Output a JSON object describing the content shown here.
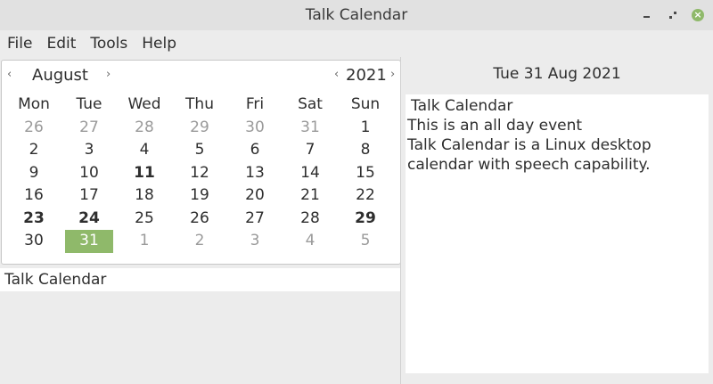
{
  "window": {
    "title": "Talk Calendar"
  },
  "menu": [
    "File",
    "Edit",
    "Tools",
    "Help"
  ],
  "calendar": {
    "month": "August",
    "year": "2021",
    "month_prev": "‹",
    "month_next": "›",
    "year_prev": "‹",
    "year_next": "›",
    "weekdays": [
      "Mon",
      "Tue",
      "Wed",
      "Thu",
      "Fri",
      "Sat",
      "Sun"
    ],
    "weeks": [
      [
        {
          "d": "26",
          "o": true
        },
        {
          "d": "27",
          "o": true
        },
        {
          "d": "28",
          "o": true
        },
        {
          "d": "29",
          "o": true
        },
        {
          "d": "30",
          "o": true
        },
        {
          "d": "31",
          "o": true
        },
        {
          "d": "1"
        }
      ],
      [
        {
          "d": "2"
        },
        {
          "d": "3"
        },
        {
          "d": "4"
        },
        {
          "d": "5"
        },
        {
          "d": "6"
        },
        {
          "d": "7"
        },
        {
          "d": "8"
        }
      ],
      [
        {
          "d": "9"
        },
        {
          "d": "10"
        },
        {
          "d": "11",
          "b": true
        },
        {
          "d": "12"
        },
        {
          "d": "13"
        },
        {
          "d": "14"
        },
        {
          "d": "15"
        }
      ],
      [
        {
          "d": "16"
        },
        {
          "d": "17"
        },
        {
          "d": "18"
        },
        {
          "d": "19"
        },
        {
          "d": "20"
        },
        {
          "d": "21"
        },
        {
          "d": "22"
        }
      ],
      [
        {
          "d": "23",
          "b": true
        },
        {
          "d": "24",
          "b": true
        },
        {
          "d": "25"
        },
        {
          "d": "26"
        },
        {
          "d": "27"
        },
        {
          "d": "28"
        },
        {
          "d": "29",
          "b": true
        }
      ],
      [
        {
          "d": "30"
        },
        {
          "d": "31",
          "s": true
        },
        {
          "d": "1",
          "o": true
        },
        {
          "d": "2",
          "o": true
        },
        {
          "d": "3",
          "o": true
        },
        {
          "d": "4",
          "o": true
        },
        {
          "d": "5",
          "o": true
        }
      ]
    ],
    "selected_color": "#8fb96a"
  },
  "event_list": {
    "items": [
      "Talk Calendar"
    ]
  },
  "details": {
    "date": "Tue 31 Aug 2021",
    "lines": [
      "Talk Calendar",
      "This is an all day event",
      "Talk Calendar is a Linux desktop",
      "calendar with speech capability."
    ]
  },
  "icons": {
    "minimize": "minimize-icon",
    "maximize": "maximize-icon",
    "close": "close-icon"
  }
}
